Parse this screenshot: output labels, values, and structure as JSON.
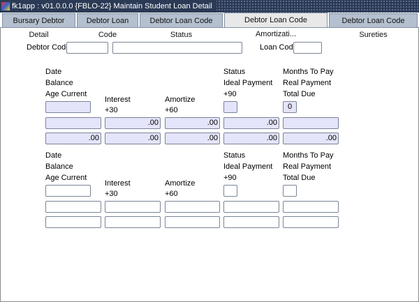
{
  "window": {
    "title": "fk1app : v01.0.0.0 {FBLO-22} Maintain Student Loan Detail"
  },
  "tabs": [
    {
      "label": "Bursary Debtor Detail"
    },
    {
      "label": "Debtor Loan Code"
    },
    {
      "label": "Debtor Loan Code Status"
    },
    {
      "label": "Debtor Loan Code Amortizati...",
      "active": true
    },
    {
      "label": "Debtor Loan Code Sureties"
    }
  ],
  "header": {
    "debtor_code_label": "Debtor Code",
    "debtor_code": "",
    "debtor_name": "",
    "loan_code_label": "Loan Code",
    "loan_code": ""
  },
  "labels": {
    "date": "Date",
    "balance": "Balance",
    "age_current": "Age Current",
    "interest": "Interest",
    "p30": "+30",
    "amortize": "Amortize",
    "p60": "+60",
    "status": "Status",
    "ideal_payment": "Ideal Payment",
    "p90": "+90",
    "months_to_pay": "Months To Pay",
    "real_payment": "Real  Payment",
    "total_due": "Total Due"
  },
  "block1": {
    "date": "",
    "status": "",
    "months": "0",
    "row2": [
      "",
      ".00",
      ".00",
      ".00",
      ""
    ],
    "row3": [
      ".00",
      ".00",
      ".00",
      ".00",
      ".00"
    ]
  },
  "block2": {
    "date": "",
    "status": "",
    "months": "",
    "row2": [
      "",
      "",
      "",
      "",
      ""
    ],
    "row3": [
      "",
      "",
      "",
      "",
      ""
    ]
  }
}
